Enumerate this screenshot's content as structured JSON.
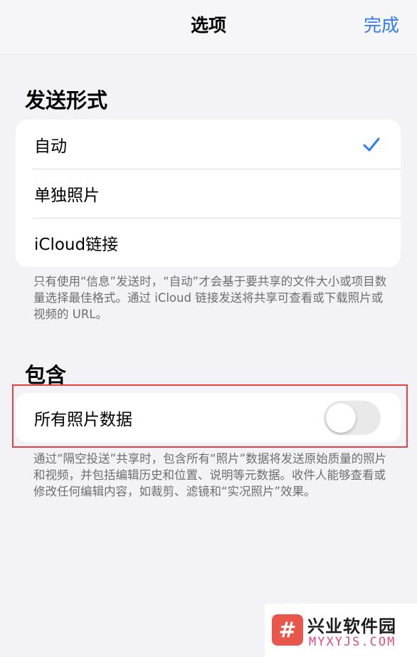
{
  "navbar": {
    "title": "选项",
    "done_label": "完成"
  },
  "send_as": {
    "header": "发送形式",
    "options": [
      {
        "label": "自动",
        "selected": true
      },
      {
        "label": "单独照片",
        "selected": false
      },
      {
        "label": "iCloud链接",
        "selected": false
      }
    ],
    "footer": "只有使用“信息”发送时，“自动”才会基于要共享的文件大小或项目数量选择最佳格式。通过 iCloud 链接发送将共享可查看或下载照片或视频的 URL。"
  },
  "include": {
    "header": "包含",
    "all_photos_data": {
      "label": "所有照片数据",
      "on": false
    },
    "footer": "通过“隔空投送”共享时，包含所有“照片”数据将发送原始质量的照片和视频，并包括编辑历史和位置、说明等元数据。收件人能够查看或修改任何编辑内容，如裁剪、滤镜和“实况照片”效果。"
  },
  "colors": {
    "accent": "#2f7cf6",
    "highlight": "#e24444",
    "background": "#f2f2f7"
  },
  "watermark": {
    "name": "兴业软件园",
    "domain": "MYXYJS.COM",
    "logo_icon": "hash-icon"
  }
}
